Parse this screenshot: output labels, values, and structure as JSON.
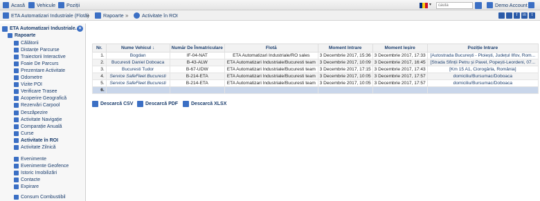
{
  "topnav": {
    "home": "Acasă",
    "vehicles": "Vehicule",
    "positions": "Poziții",
    "search_placeholder": "caută",
    "account": "Demo Account"
  },
  "breadcrumb": {
    "company": "ETA Automatizari Industriale (Flotă)",
    "reports": "Rapoarte",
    "current": "Activitate în ROI"
  },
  "sidebar": {
    "header": "ETA Automatizari Industriale...",
    "section": "Rapoarte",
    "items": [
      "Călătorii",
      "Distanțe Parcurse",
      "Traiectorii Interactive",
      "Foaie De Parcurs",
      "Prezentare Activitate",
      "Odometre",
      "Vizite POI",
      "Verificare Trasee",
      "Acoperire Geografică",
      "Rezervări Carpool",
      "Deszăpezire",
      "Activitate Navigație",
      "Comparație Anuală",
      "Curse",
      "Activitate în ROI",
      "Activitate Zilnică"
    ],
    "items2": [
      "Evenimente",
      "Evenimente Geofence",
      "Istoric Imobilizări",
      "Contacte",
      "Expirare"
    ],
    "items3": [
      "Consum Combustibil"
    ],
    "active": "Activitate în ROI"
  },
  "table": {
    "headers": [
      "Nr.",
      "Nume Vehicul",
      "Număr De Înmatriculare",
      "Flotă",
      "Moment Intrare",
      "Moment Ieșire",
      "Poziție Intrare"
    ],
    "rows": [
      {
        "nr": "1.",
        "name": "Bogdan",
        "plate": "IF-04-NAT",
        "fleet": "ETA Automatizari Industriale/RO sales",
        "in": "3 Decembrie 2017, 15:36",
        "out": "3 Decembrie 2017, 17:33",
        "pos": "[Autostrada București - Ploiești, Județul Ilfov, Rom..."
      },
      {
        "nr": "2.",
        "name": "Bucuresti Daniel Doboaca",
        "plate": "B-43-ALW",
        "fleet": "ETA Automatizari Industriale/Bucuresti team",
        "in": "3 Decembrie 2017, 10:09",
        "out": "3 Decembrie 2017, 16:45",
        "pos": "[Strada Sfinții Petru și Pavel, Popești-Leordeni, 07..."
      },
      {
        "nr": "3.",
        "name": "Bucuresti Tudor",
        "plate": "B-67-UDW",
        "fleet": "ETA Automatizari Industriale/Bucuresti team",
        "in": "3 Decembrie 2017, 17:15",
        "out": "3 Decembrie 2017, 17:43",
        "pos": "[Km 15 A1, Ciorogârla, România]"
      },
      {
        "nr": "4.",
        "name": "Service SafeFleet Bucuresti",
        "plate": "B-214-ETA",
        "fleet": "ETA Automatizari Industriale/Bucuresti team",
        "in": "3 Decembrie 2017, 10:05",
        "out": "3 Decembrie 2017, 17:57",
        "pos": "domiciliu/Bursumac/Doboaca"
      },
      {
        "nr": "5.",
        "name": "Service SafeFleet Bucuresti",
        "plate": "B-214-ETA",
        "fleet": "ETA Automatizari Industriale/Bucuresti team",
        "in": "3 Decembrie 2017, 10:05",
        "out": "3 Decembrie 2017, 17:57",
        "pos": "domiciliu/Bursumac/Doboaca"
      },
      {
        "nr": "6.",
        "name": "",
        "plate": "",
        "fleet": "",
        "in": "",
        "out": "",
        "pos": ""
      }
    ]
  },
  "downloads": {
    "csv": "Descarcă CSV",
    "pdf": "Descarcă PDF",
    "xlsx": "Descarcă XLSX"
  },
  "colors": {
    "link": "#1a3d6d",
    "selected_row": "#c9d6ea"
  }
}
